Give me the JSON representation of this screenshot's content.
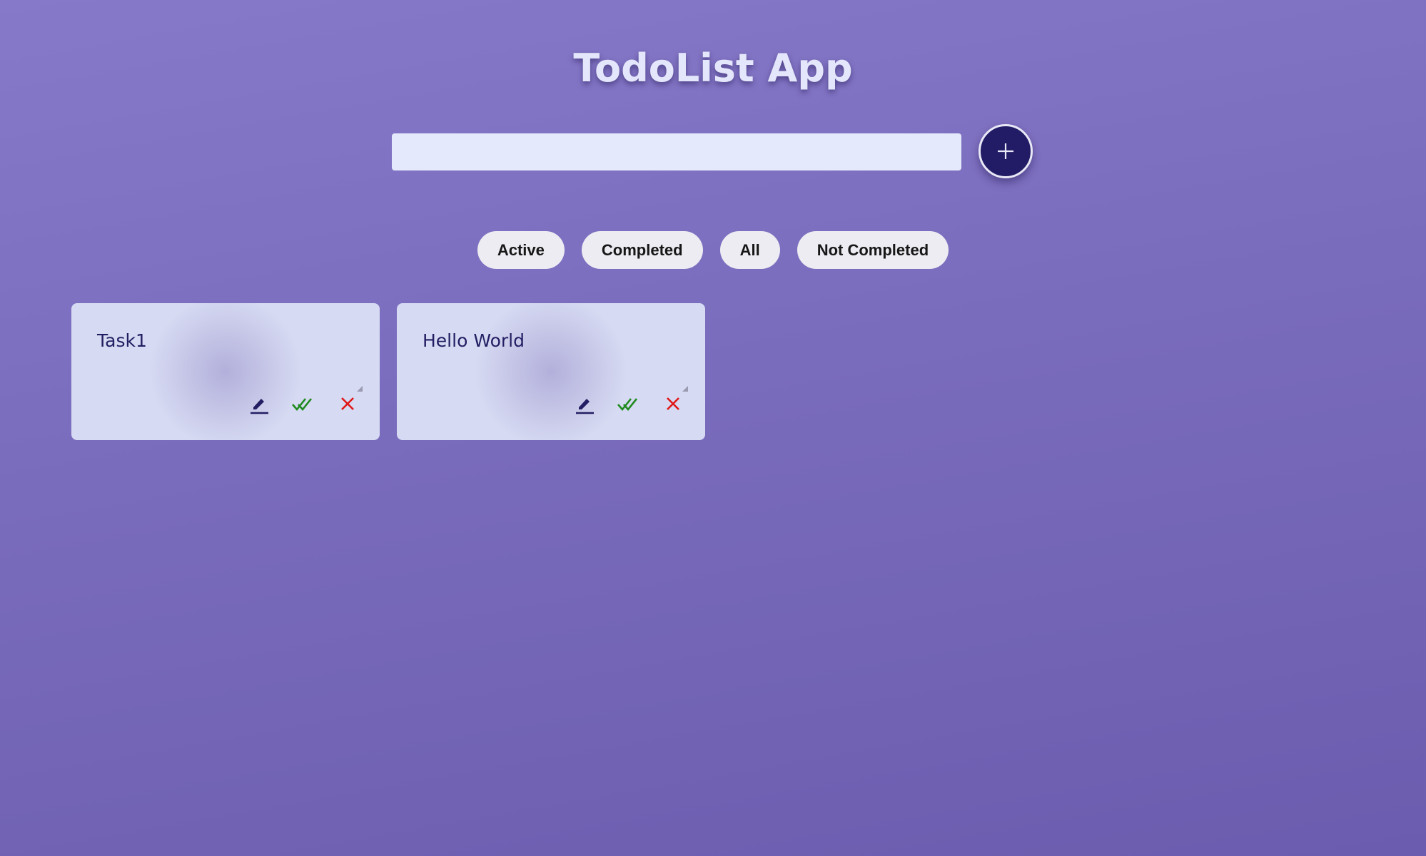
{
  "app": {
    "title": "TodoList App"
  },
  "input": {
    "value": "",
    "placeholder": ""
  },
  "add_button": {
    "icon": "plus-icon"
  },
  "filters": [
    {
      "label": "Active"
    },
    {
      "label": "Completed"
    },
    {
      "label": "All"
    },
    {
      "label": "Not Completed"
    }
  ],
  "todos": [
    {
      "title": "Task1",
      "actions": [
        "edit-icon",
        "double-check-icon",
        "close-icon"
      ]
    },
    {
      "title": "Hello World",
      "actions": [
        "edit-icon",
        "double-check-icon",
        "close-icon"
      ]
    }
  ],
  "colors": {
    "accent": "#221c66",
    "complete": "#1f8a1f",
    "delete": "#e01818",
    "edit": "#231e63"
  }
}
